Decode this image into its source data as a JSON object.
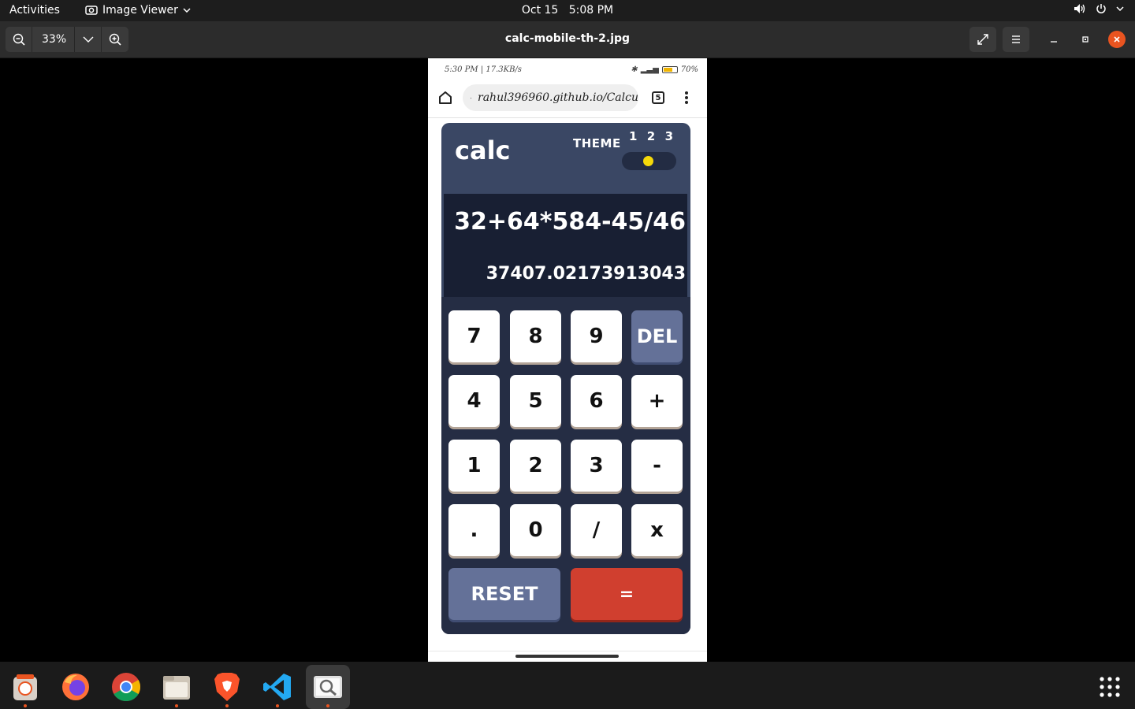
{
  "topbar": {
    "activities": "Activities",
    "app_name": "Image Viewer",
    "clock_date": "Oct 15",
    "clock_time": "5:08 PM"
  },
  "headerbar": {
    "zoom": "33%",
    "title": "calc-mobile-th-2.jpg"
  },
  "phone": {
    "status_left": "5:30 PM | 17.3KB/s",
    "battery": "70%",
    "battery_level": 0.7,
    "url": "rahul396960.github.io/Calcu",
    "tab_count": "5"
  },
  "calc": {
    "logo": "calc",
    "theme_label": "THEME",
    "theme_options": [
      "1",
      "2",
      "3"
    ],
    "expression": "32+64*584-45/46",
    "result": "37407.02173913043",
    "keys": {
      "k7": "7",
      "k8": "8",
      "k9": "9",
      "del": "DEL",
      "k4": "4",
      "k5": "5",
      "k6": "6",
      "plus": "+",
      "k1": "1",
      "k2": "2",
      "k3": "3",
      "minus": "-",
      "dot": ".",
      "k0": "0",
      "divide": "/",
      "multiply": "x",
      "reset": "RESET",
      "equals": "="
    },
    "colors": {
      "main_bg": "#3a4764",
      "screen_bg": "#181f33",
      "keypad_bg": "#252d44",
      "key_bg": "#ffffff",
      "del_reset_bg": "#647198",
      "equals_bg": "#d03f2f",
      "toggle_knob": "#f5d90a"
    }
  },
  "dock": {
    "items": [
      "ubuntu-software-icon",
      "firefox-icon",
      "chrome-icon",
      "files-icon",
      "brave-icon",
      "vscode-icon",
      "image-viewer-icon"
    ],
    "apps_grid": "show-applications-icon"
  }
}
